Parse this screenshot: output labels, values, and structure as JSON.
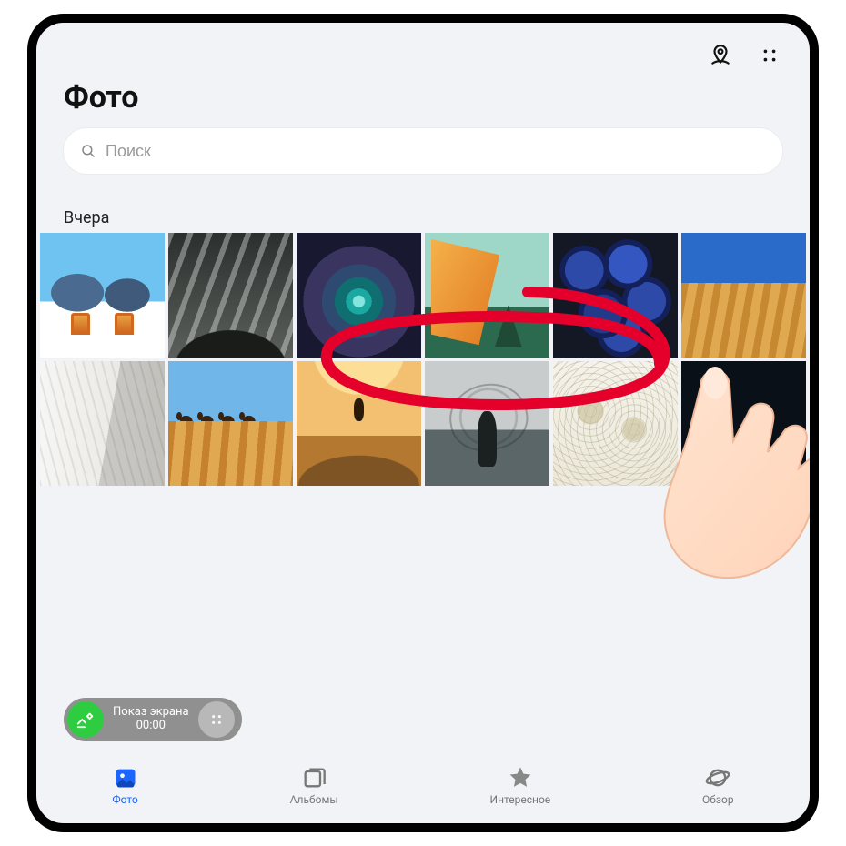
{
  "header": {
    "title": "Фото"
  },
  "search": {
    "placeholder": "Поиск"
  },
  "section": {
    "label": "Вчера"
  },
  "pill": {
    "line1": "Показ экрана",
    "line2": "00:00"
  },
  "nav": {
    "items": [
      {
        "key": "photos",
        "label": "Фото",
        "active": true
      },
      {
        "key": "albums",
        "label": "Альбомы",
        "active": false
      },
      {
        "key": "highlights",
        "label": "Интересное",
        "active": false
      },
      {
        "key": "browse",
        "label": "Обзор",
        "active": false
      }
    ]
  },
  "annotation": {
    "type": "circled-red",
    "target": "thumbnails 3–5 in row 1",
    "gesture": "finger-pointing"
  }
}
